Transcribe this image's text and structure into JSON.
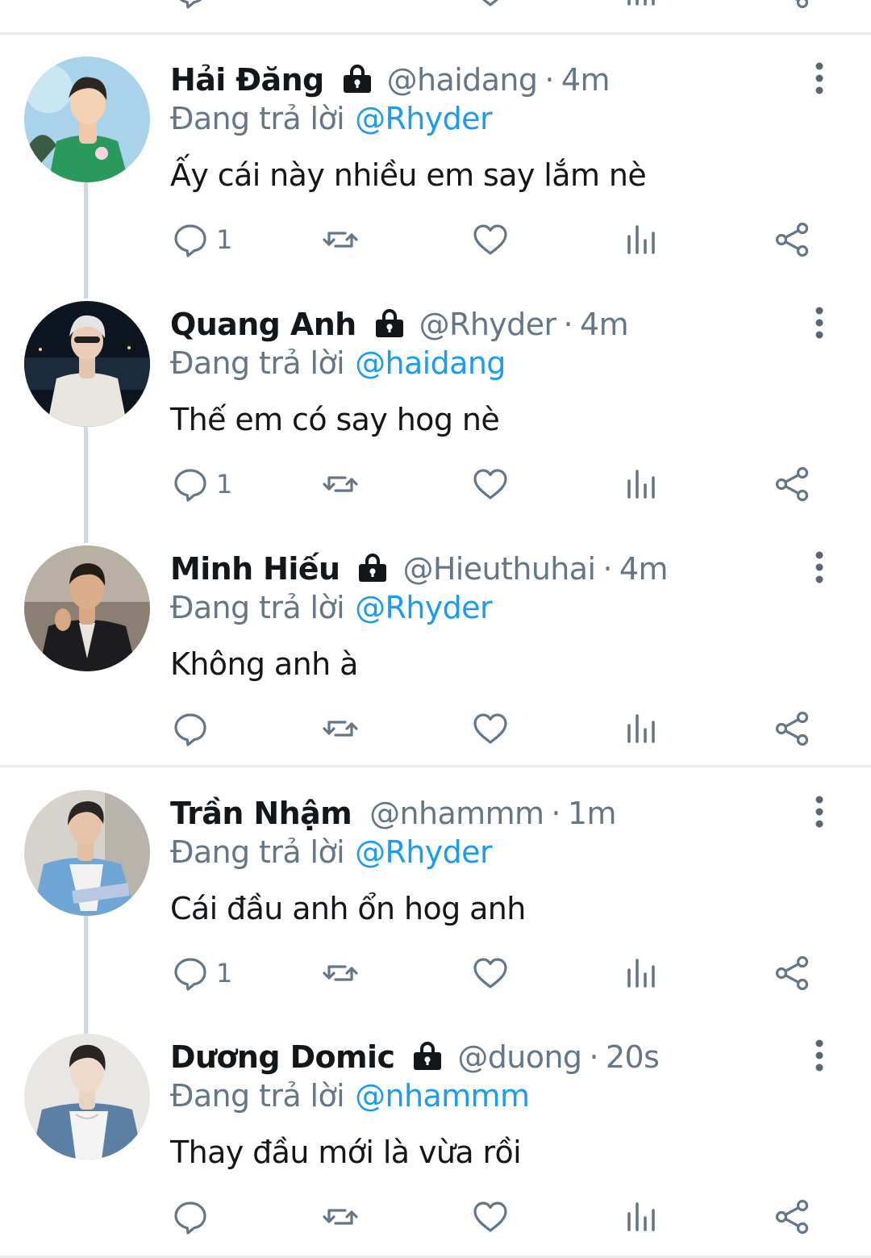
{
  "top_actions": {
    "icons": [
      "reply-icon",
      "retweet-icon",
      "like-icon",
      "analytics-icon",
      "share-icon"
    ]
  },
  "colors": {
    "name": "#14171a",
    "secondary": "#657786",
    "mention": "#1d9bf0",
    "divider": "#e6ecf0",
    "thread_line": "#d0d7de"
  },
  "tweets": [
    {
      "name": "Hải Đăng",
      "locked": true,
      "handle": "@haidang",
      "separator": "·",
      "time": "4m",
      "reply_prefix": "Đang trả lời",
      "reply_to": "@Rhyder",
      "text": "Ấy cái này nhiều em say lắm nè",
      "reply_count": "1"
    },
    {
      "name": "Quang Anh",
      "locked": true,
      "handle": "@Rhyder",
      "separator": "·",
      "time": "4m",
      "reply_prefix": "Đang trả lời",
      "reply_to": "@haidang",
      "text": "Thế em có say hog nè",
      "reply_count": "1"
    },
    {
      "name": "Minh Hiếu",
      "locked": true,
      "handle": "@Hieuthuhai",
      "separator": "·",
      "time": "4m",
      "reply_prefix": "Đang trả lời",
      "reply_to": "@Rhyder",
      "text": "Không anh à",
      "reply_count": ""
    },
    {
      "name": "Trần Nhậm",
      "locked": false,
      "handle": "@nhammm",
      "separator": "·",
      "time": "1m",
      "reply_prefix": "Đang trả lời",
      "reply_to": "@Rhyder",
      "text": "Cái đầu anh ổn hog anh",
      "reply_count": "1"
    },
    {
      "name": "Dương Domic",
      "locked": true,
      "handle": "@duong",
      "separator": "·",
      "time": "20s",
      "reply_prefix": "Đang trả lời",
      "reply_to": "@nhammm",
      "text": "Thay đầu mới là vừa rồi",
      "reply_count": ""
    }
  ]
}
